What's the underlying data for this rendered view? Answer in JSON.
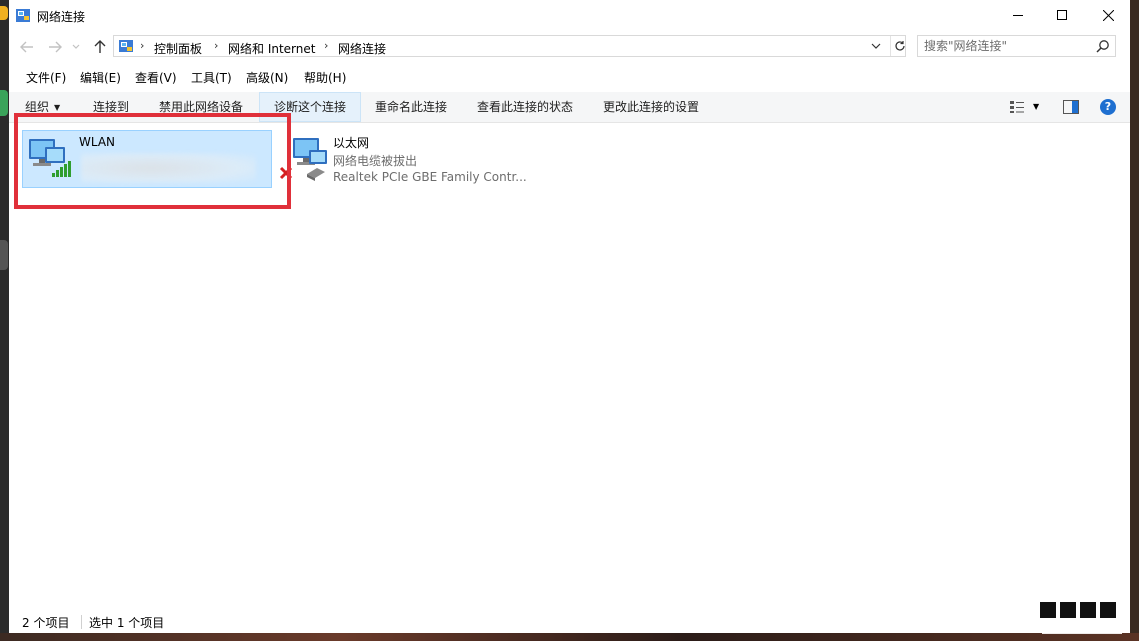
{
  "window": {
    "title": "网络连接"
  },
  "address": {
    "crumbs": [
      "控制面板",
      "网络和 Internet",
      "网络连接"
    ],
    "search_placeholder": "搜索\"网络连接\""
  },
  "menu": [
    "文件(F)",
    "编辑(E)",
    "查看(V)",
    "工具(T)",
    "高级(N)",
    "帮助(H)"
  ],
  "commands": {
    "organize": "组织",
    "connect_to": "连接到",
    "disable": "禁用此网络设备",
    "diagnose": "诊断这个连接",
    "rename": "重命名此连接",
    "view_status": "查看此连接的状态",
    "change_settings": "更改此连接的设置"
  },
  "connections": [
    {
      "name": "WLAN",
      "status": "",
      "device": "",
      "selected": true,
      "signal_bars": 5
    },
    {
      "name": "以太网",
      "status": "网络电缆被拔出",
      "device": "Realtek PCIe GBE Family Contr...",
      "selected": false
    }
  ],
  "status": {
    "count": "2 个项目",
    "selected": "选中 1 个项目"
  },
  "colors": {
    "selection_bg": "#cce8ff",
    "selection_border": "#99d1ff",
    "highlight": "#e0303a",
    "help_blue": "#1e6fd0",
    "signal_green": "#2f9e2f",
    "unplugged_red": "#d42020"
  },
  "icons": {
    "app": "network-connections-icon",
    "back": "back-arrow-icon",
    "forward": "forward-arrow-icon",
    "recent": "chevron-down-icon",
    "up": "up-arrow-icon",
    "refresh": "refresh-icon",
    "search": "search-icon",
    "help": "help-icon"
  }
}
